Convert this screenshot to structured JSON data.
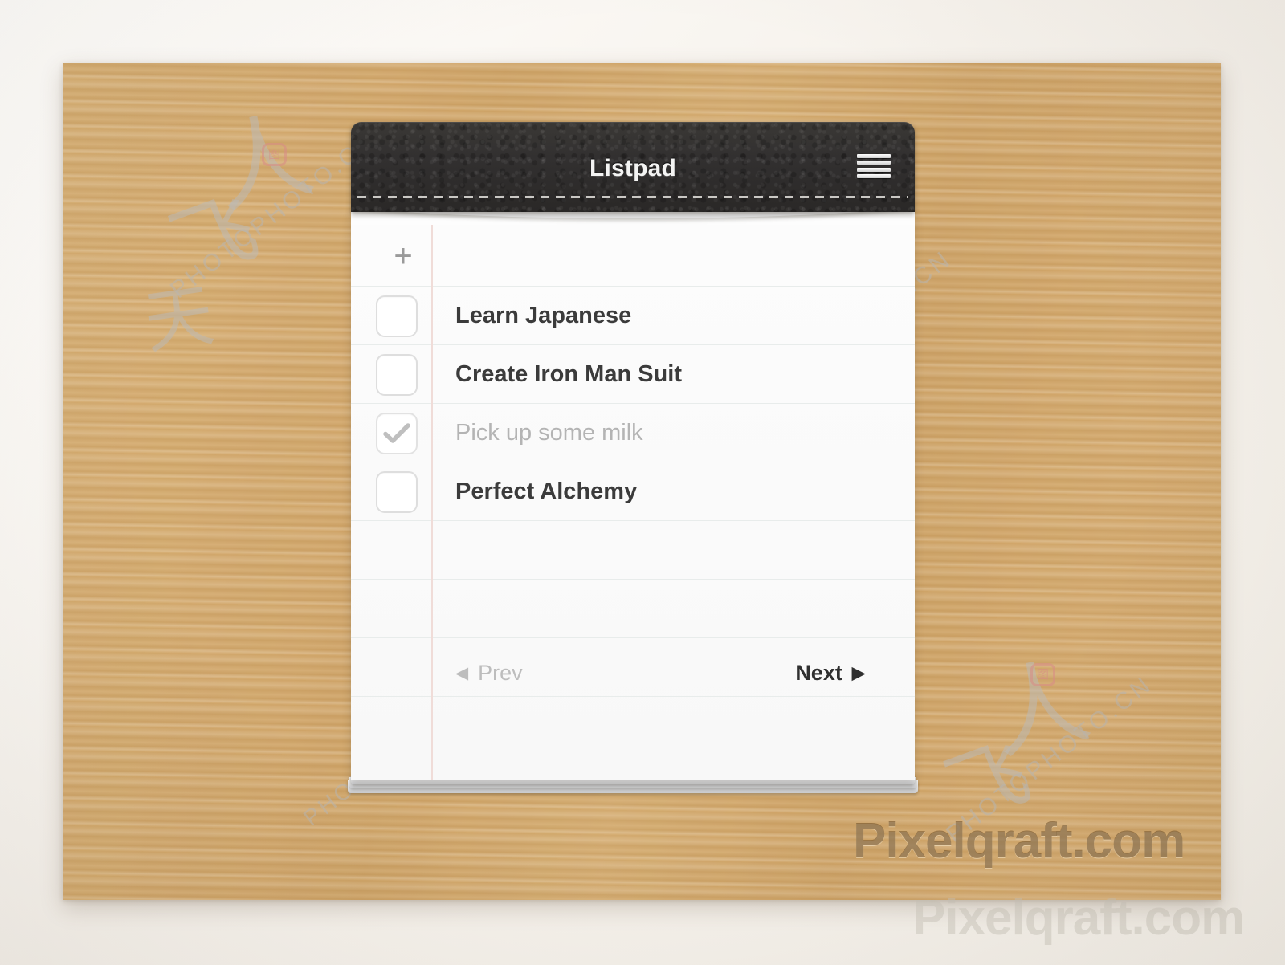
{
  "app": {
    "title": "Listpad",
    "menu_icon": "hamburger-menu-icon"
  },
  "toolbar": {
    "add_label": "+"
  },
  "tasks": [
    {
      "label": "Learn Japanese",
      "done": false
    },
    {
      "label": "Create Iron Man Suit",
      "done": false
    },
    {
      "label": "Pick up some milk",
      "done": true
    },
    {
      "label": "Perfect Alchemy",
      "done": false
    }
  ],
  "footer": {
    "prev_label": "Prev",
    "next_label": "Next",
    "prev_arrow": "◀",
    "next_arrow": "▶"
  },
  "branding": {
    "engraved_text": "Pixelqraft.com",
    "ghost_text": "Pixelqraft.com"
  },
  "watermarks": {
    "site_text": "PHOTOPHOTO.CN",
    "glyph_a": "人",
    "glyph_b": "飞",
    "glyph_c": "天",
    "seal": "图"
  },
  "colors": {
    "wood": "#e3c490",
    "leather": "#302e2c",
    "paper": "#fbfbfb",
    "rule_line": "#e8eceb",
    "margin_line": "#f0dcd8",
    "task_text": "#3b3b3b",
    "task_done_text": "#b4b4b4",
    "next_text": "#303030",
    "prev_text": "#bdbdbd",
    "engraving": "#684922"
  }
}
